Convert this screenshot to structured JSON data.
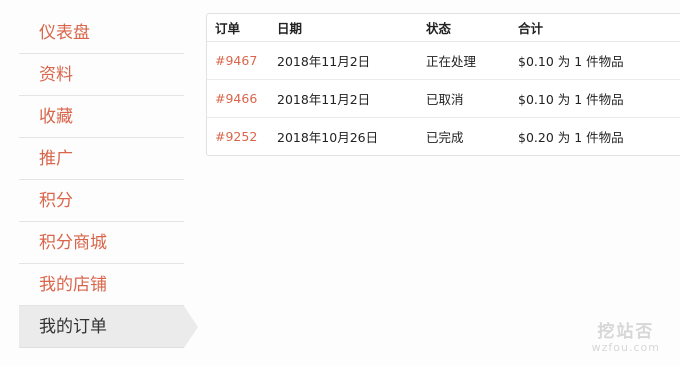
{
  "sidebar": {
    "items": [
      {
        "label": "仪表盘"
      },
      {
        "label": "资料"
      },
      {
        "label": "收藏"
      },
      {
        "label": "推广"
      },
      {
        "label": "积分"
      },
      {
        "label": "积分商城"
      },
      {
        "label": "我的店铺"
      },
      {
        "label": "我的订单",
        "active": true
      }
    ]
  },
  "orders": {
    "headers": {
      "order": "订单",
      "date": "日期",
      "status": "状态",
      "total": "合计"
    },
    "rows": [
      {
        "order": "#9467",
        "date": "2018年11月2日",
        "status": "正在处理",
        "total": "$0.10 为 1 件物品"
      },
      {
        "order": "#9466",
        "date": "2018年11月2日",
        "status": "已取消",
        "total": "$0.10 为 1 件物品"
      },
      {
        "order": "#9252",
        "date": "2018年10月26日",
        "status": "已完成",
        "total": "$0.20 为 1 件物品"
      }
    ]
  },
  "watermark": {
    "brand": "挖站否",
    "site": "wzfou.com"
  },
  "colors": {
    "accent": "#d9664b",
    "active_bg": "#ebebeb",
    "text": "#222222"
  }
}
